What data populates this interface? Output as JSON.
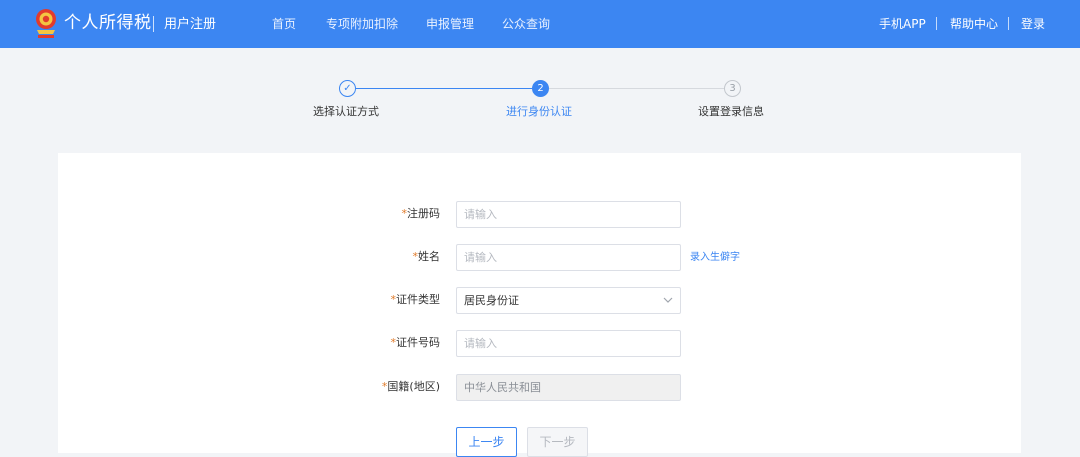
{
  "header": {
    "app_title": "个人所得税",
    "page_subtitle": "用户注册",
    "nav": [
      "首页",
      "专项附加扣除",
      "申报管理",
      "公众查询"
    ],
    "right_links": [
      "手机APP",
      "帮助中心",
      "登录"
    ],
    "brand_color": "#3c86f2"
  },
  "steps": [
    {
      "label": "选择认证方式",
      "marker": "✓",
      "state": "done"
    },
    {
      "label": "进行身份认证",
      "marker": "2",
      "state": "active"
    },
    {
      "label": "设置登录信息",
      "marker": "3",
      "state": "todo"
    }
  ],
  "form": {
    "required_mark": "*",
    "fields": [
      {
        "label": "注册码",
        "value": "",
        "placeholder": "请输入"
      },
      {
        "label": "姓名",
        "value": "",
        "placeholder": "请输入"
      },
      {
        "label": "证件类型",
        "value": "居民身份证",
        "placeholder": ""
      },
      {
        "label": "证件号码",
        "value": "",
        "placeholder": "请输入"
      },
      {
        "label": "国籍(地区)",
        "value": "中华人民共和国",
        "placeholder": ""
      }
    ],
    "rare_char_link": "录入生僻字",
    "prev_button": "上一步",
    "next_button": "下一步"
  }
}
